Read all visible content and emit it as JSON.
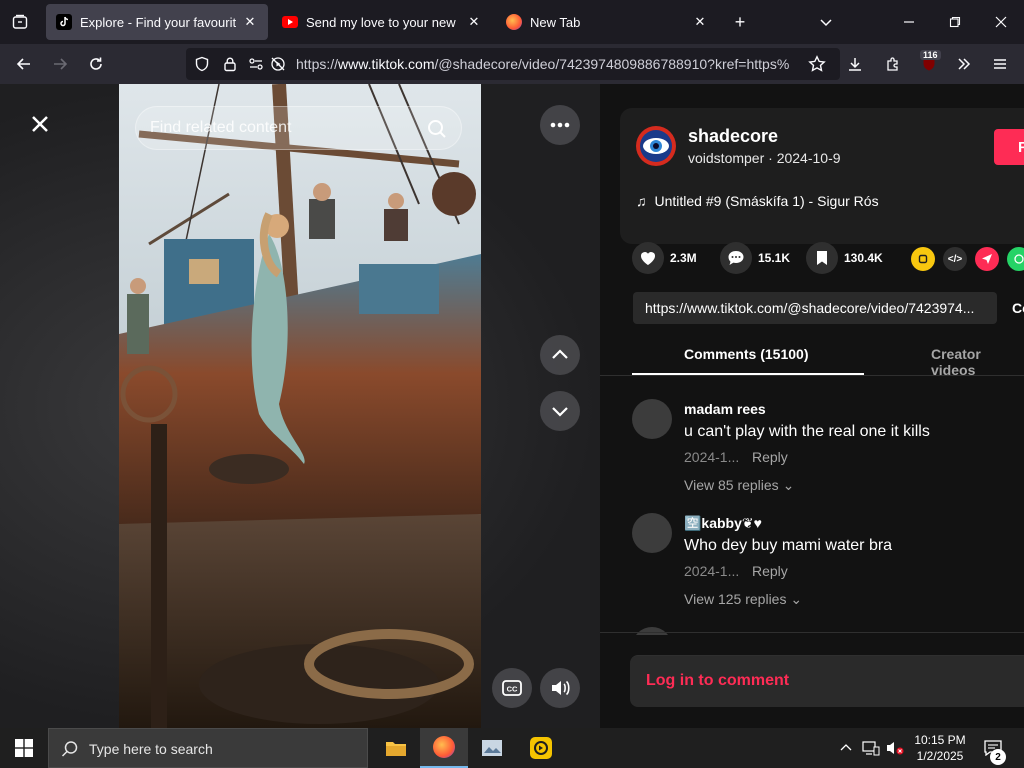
{
  "browser": {
    "tabs": [
      {
        "title": "Explore - Find your favourite vi",
        "favicon": "tiktok-icon",
        "active": true
      },
      {
        "title": "Send my love to your new lover",
        "favicon": "youtube-icon",
        "active": false
      },
      {
        "title": "New Tab",
        "favicon": "firefox-icon",
        "active": false
      }
    ],
    "url_prefix": "https://",
    "url_host": "www.tiktok.com",
    "url_rest": "/@shadecore/video/7423974809886788910?kref=https%",
    "extension_badge": "116"
  },
  "video": {
    "search_placeholder": "Find related content"
  },
  "panel": {
    "author_name": "shadecore",
    "author_sub": "voidstomper · 2024-10-9",
    "follow_label": "F",
    "music": "Untitled #9 (Smáskífa 1) - Sigur Rós",
    "likes": "2.3M",
    "comments_count": "15.1K",
    "saves": "130.4K",
    "link": "https://www.tiktok.com/@shadecore/video/7423974...",
    "copy_label": "Co",
    "tab_comments": "Comments (15100)",
    "tab_creator": "Creator videos",
    "comments": [
      {
        "user": "madam rees",
        "text": "u can't play with the real one it kills",
        "date": "2024-1...",
        "reply": "Reply",
        "replies": "View 85 replies"
      },
      {
        "user": "🈳kabby❦♥",
        "text": "Who dey buy mami water bra",
        "date": "2024-1...",
        "reply": "Reply",
        "replies": "View 125 replies"
      }
    ],
    "login_label": "Log in to comment"
  },
  "taskbar": {
    "search_text": "Type here to search",
    "time": "10:15 PM",
    "date": "1/2/2025",
    "notifications": "2"
  },
  "colors": {
    "accent": "#fe2c55",
    "tab_bg": "#1c1b22",
    "active_tab": "#42414d",
    "navbar": "#2b2a33"
  }
}
